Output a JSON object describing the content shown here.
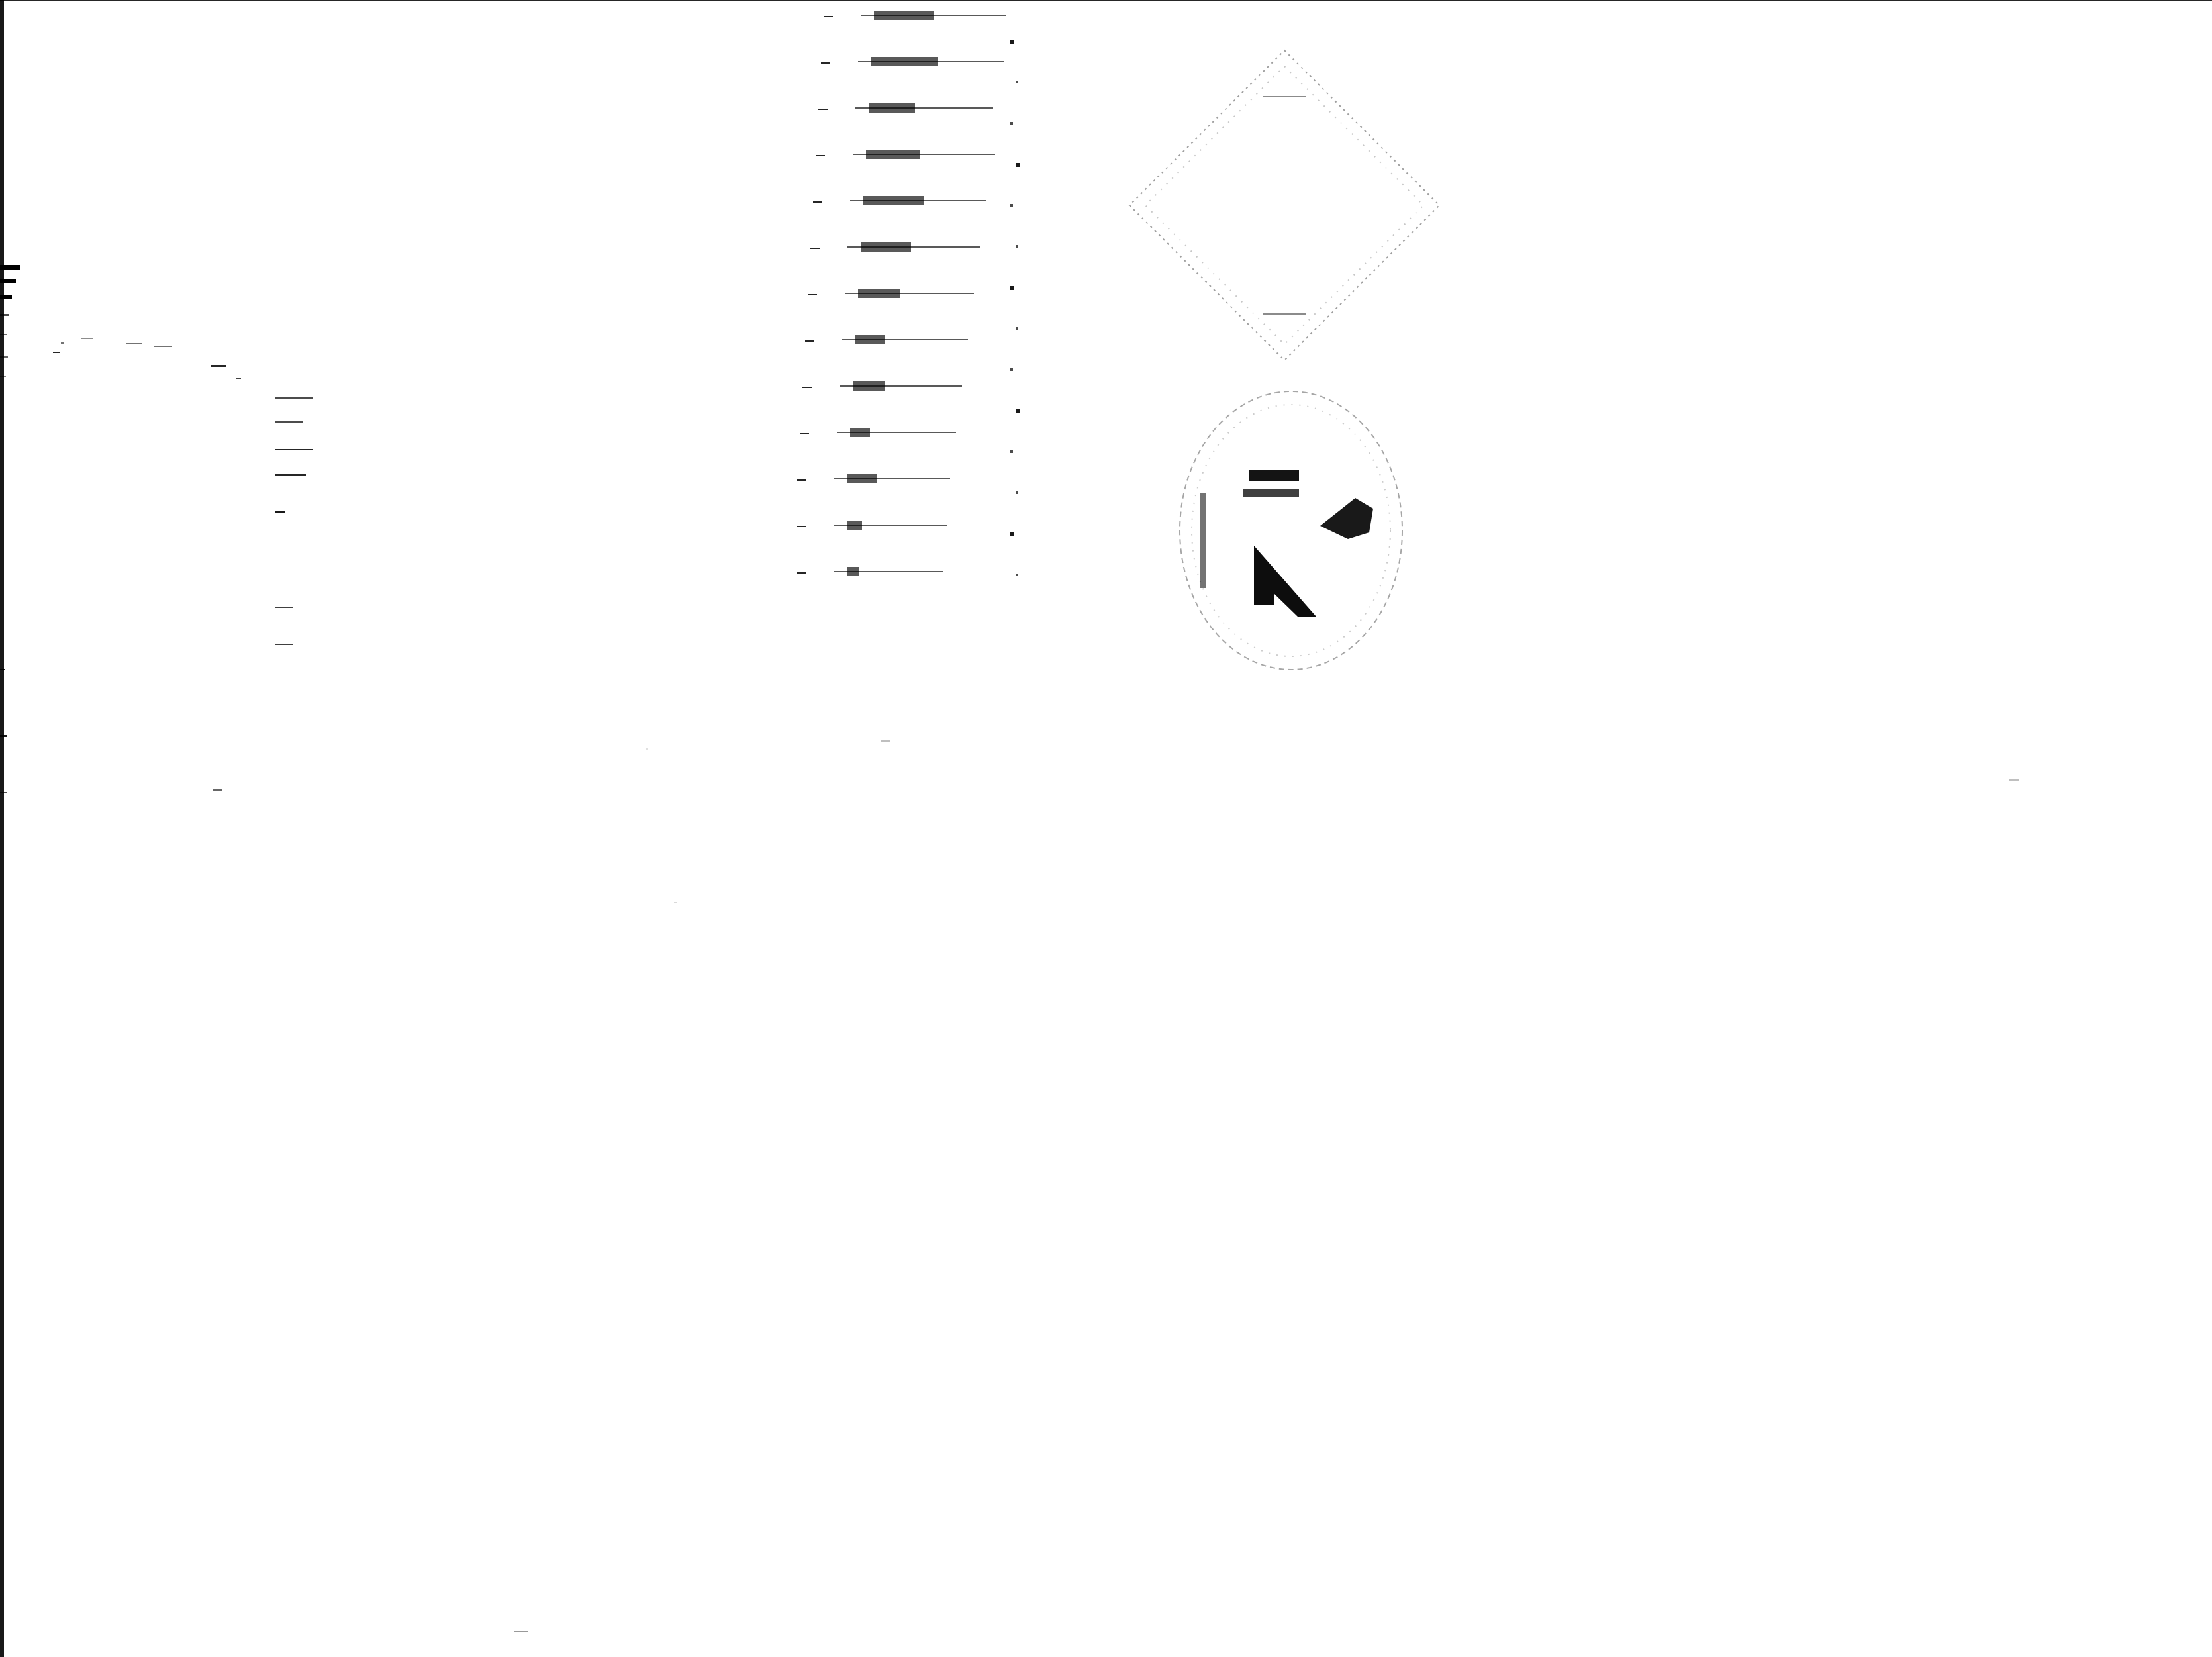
{
  "screen": {
    "title": "",
    "background": "#ffffff",
    "ink": "#000000"
  },
  "icons": {
    "diamond": "diamond-outline-icon",
    "circle": "circle-k-icon"
  },
  "left_panel": {
    "ticks": [
      {
        "name": "left-tick-1"
      },
      {
        "name": "left-tick-2"
      },
      {
        "name": "left-tick-3"
      },
      {
        "name": "left-tick-4"
      },
      {
        "name": "left-tick-5"
      },
      {
        "name": "left-tick-6"
      },
      {
        "name": "left-tick-7"
      },
      {
        "name": "left-tick-8"
      },
      {
        "name": "left-tick-9"
      },
      {
        "name": "left-tick-10"
      }
    ]
  },
  "tower": {
    "rows": [
      {
        "line": 220,
        "block": 90
      },
      {
        "line": 220,
        "block": 100
      },
      {
        "line": 208,
        "block": 70
      },
      {
        "line": 215,
        "block": 82
      },
      {
        "line": 205,
        "block": 92
      },
      {
        "line": 200,
        "block": 76
      },
      {
        "line": 195,
        "block": 64
      },
      {
        "line": 190,
        "block": 44
      },
      {
        "line": 185,
        "block": 48
      },
      {
        "line": 180,
        "block": 30
      },
      {
        "line": 175,
        "block": 44
      },
      {
        "line": 170,
        "block": 22
      },
      {
        "line": 165,
        "block": 18
      }
    ]
  },
  "rail": {
    "markers": 14
  }
}
